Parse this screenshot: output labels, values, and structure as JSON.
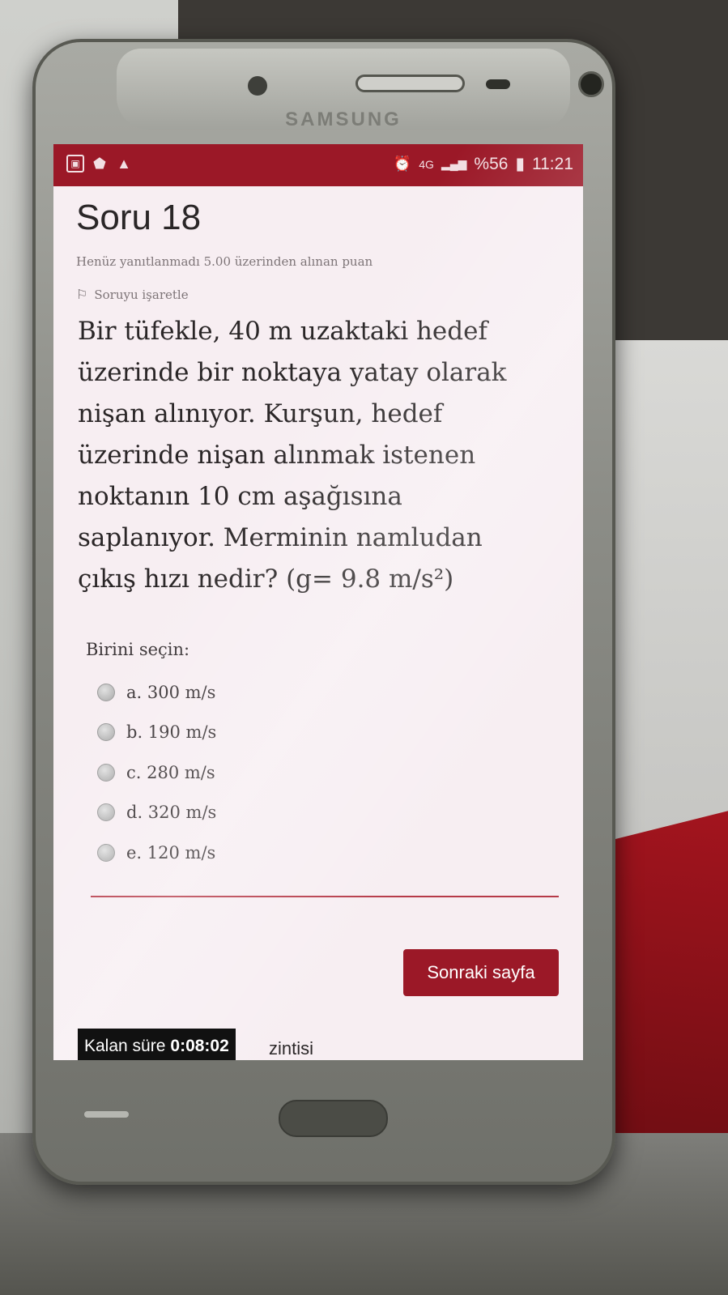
{
  "status_bar": {
    "left_icons": [
      "image-icon",
      "shield-icon",
      "warning-icon"
    ],
    "alarm_icon": "alarm-icon",
    "network": "4G",
    "signal_icon": "signal-icon",
    "battery": "%56",
    "battery_icon": "battery-icon",
    "time": "11:21"
  },
  "question": {
    "title": "Soru 18",
    "status": "Henüz yanıtlanmadı",
    "grade": "5.00 üzerinden alınan puan",
    "flag_label": "Soruyu işaretle",
    "flag_icon": "flag-icon",
    "text": "Bir tüfekle, 40 m uzaktaki hedef üzerinde bir noktaya yatay olarak nişan alınıyor. Kurşun, hedef üzerinde nişan alınmak istenen noktanın 10 cm aşağısına saplanıyor. Merminin namludan çıkış hızı nedir? (g= 9.8 m/s²)",
    "choose_label": "Birini seçin:",
    "options": [
      {
        "label": "a. 300 m/s"
      },
      {
        "label": "b. 190 m/s"
      },
      {
        "label": "c. 280 m/s"
      },
      {
        "label": "d. 320 m/s"
      },
      {
        "label": "e. 120 m/s"
      }
    ]
  },
  "navigation": {
    "next_label": "Sonraki sayfa"
  },
  "timer": {
    "label": "Kalan süre",
    "value": "0:08:02"
  },
  "footer": {
    "trailing_text": "zintisi"
  },
  "colors": {
    "accent": "#9b1827",
    "screen_background": "#f7eef2",
    "divider": "#b63a48",
    "timer_background": "#111111"
  },
  "device": {
    "brand": "SAMSUNG"
  }
}
